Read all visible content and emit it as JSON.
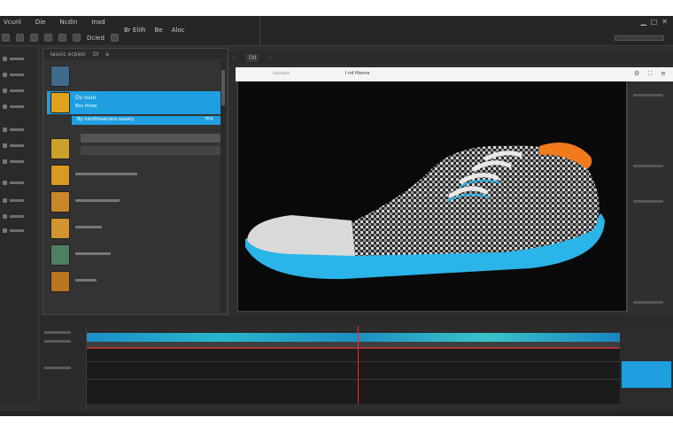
{
  "menu": {
    "row1": [
      "Vcuril",
      "Die",
      "Ncdin",
      "Inad"
    ],
    "row2_title": "Dcied",
    "row3": [
      "Br Elilh",
      "Be",
      "Aloc"
    ]
  },
  "media_browser": {
    "header": [
      "Iauvic ecpesr",
      "OI",
      "a"
    ],
    "items": [
      {
        "title": "",
        "sub": "",
        "selected": false,
        "thumb_color": "#3f6a8a"
      },
      {
        "title": "Ov ouur",
        "sub": "Bov ihhes",
        "tag": "",
        "selected": true,
        "thumb_color": "#e2a31c"
      },
      {
        "title": "",
        "sub": "",
        "selected": false,
        "thumb_color": "#caa12a"
      },
      {
        "title": "",
        "sub": "",
        "selected": false,
        "thumb_color": "#d89a22"
      },
      {
        "title": "",
        "sub": "",
        "selected": false,
        "thumb_color": "#c8872a"
      },
      {
        "title": "",
        "sub": "",
        "selected": false,
        "thumb_color": "#d1942f"
      },
      {
        "title": "",
        "sub": "",
        "selected": false,
        "thumb_color": "#4e7f61"
      },
      {
        "title": "",
        "sub": "",
        "selected": false,
        "thumb_color": "#b9761e"
      }
    ],
    "selected_subrow": "Bp lnlroPreservers eeeety",
    "selected_tag": "TP4",
    "footer": ""
  },
  "viewer": {
    "tabs": [
      "",
      "OII",
      ""
    ],
    "toolbar_text": "I nd Hiarne"
  },
  "timeline": {
    "head_labels": [
      "",
      ""
    ]
  },
  "status": {
    "left": "",
    "right": ""
  },
  "colors": {
    "accent": "#1f9fe0",
    "shoe_sole": "#2ab4e8",
    "shoe_lace": "#e8e8e8",
    "shoe_accent": "#f07a1c"
  }
}
